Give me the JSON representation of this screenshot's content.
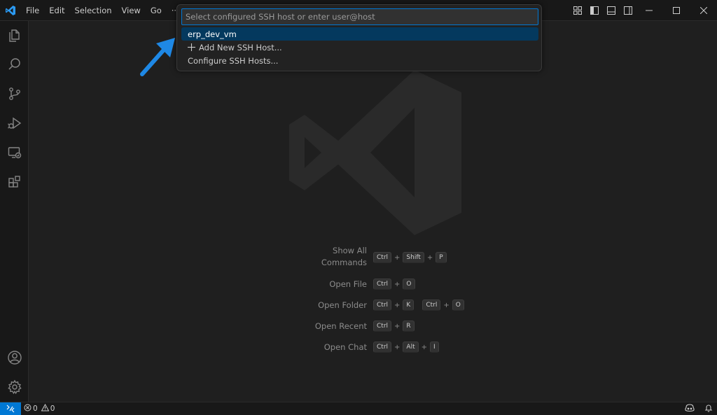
{
  "menubar": {
    "items": [
      "File",
      "Edit",
      "Selection",
      "View",
      "Go",
      "···"
    ]
  },
  "quick_pick": {
    "placeholder": "Select configured SSH host or enter user@host",
    "items": [
      {
        "label": "erp_dev_vm",
        "selected": true
      },
      {
        "label": "Add New SSH Host...",
        "icon": "plus-icon"
      },
      {
        "label": "Configure SSH Hosts..."
      }
    ]
  },
  "shortcuts": [
    {
      "label_line1": "Show All",
      "label_line2": "Commands",
      "keys": [
        [
          "Ctrl",
          "Shift",
          "P"
        ]
      ]
    },
    {
      "label": "Open File",
      "keys": [
        [
          "Ctrl",
          "O"
        ]
      ]
    },
    {
      "label": "Open Folder",
      "keys": [
        [
          "Ctrl",
          "K"
        ],
        [
          "Ctrl",
          "O"
        ]
      ]
    },
    {
      "label": "Open Recent",
      "keys": [
        [
          "Ctrl",
          "R"
        ]
      ]
    },
    {
      "label": "Open Chat",
      "keys": [
        [
          "Ctrl",
          "Alt",
          "I"
        ]
      ]
    }
  ],
  "statusbar": {
    "errors": "0",
    "warnings": "0"
  },
  "colors": {
    "accent": "#0078d4",
    "selection": "#04395e",
    "arrow": "#1e88e5"
  }
}
